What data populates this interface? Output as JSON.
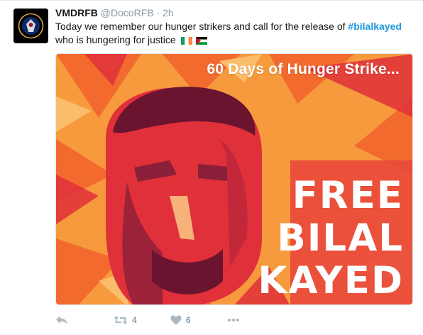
{
  "tweet": {
    "name": "VMDRFB",
    "handle": "@DocoRFB",
    "separator": "·",
    "time": "2h",
    "text_before": "Today we remember our hunger strikers and call for the release of ",
    "hashtag": "#bilalkayed",
    "text_after": "who is hungering for justice"
  },
  "media": {
    "caption": "60 Days of Hunger Strike...",
    "line1": "FREE",
    "line2": "BILAL",
    "line3": "KAYED",
    "colors": {
      "orange": "#f26a2e",
      "red": "#e0303a",
      "maroon": "#8a1f3a",
      "bg_orange": "#f79a3e"
    }
  },
  "actions": {
    "reply_icon": "reply-icon",
    "retweet_count": "4",
    "like_count": "6",
    "more_icon": "more-icon"
  }
}
